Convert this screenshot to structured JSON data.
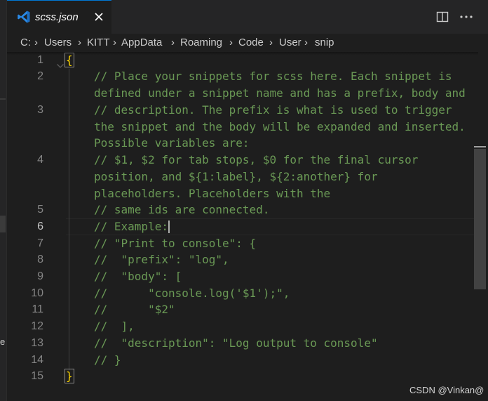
{
  "tab": {
    "icon": "vscode-file-icon",
    "label": "scss.json",
    "close_icon": "close-icon"
  },
  "toolbar": {
    "split_icon": "split-editor-icon",
    "more_icon": "more-actions-icon"
  },
  "breadcrumb": [
    "C:",
    "Users",
    "KITT",
    "AppData",
    "Roaming",
    "Code",
    "User",
    "snip"
  ],
  "editor": {
    "lines": [
      {
        "num": "1",
        "segments": [
          "{"
        ]
      },
      {
        "num": "2",
        "segments": [
          "// Place your snippets for scss here. Each snippet is",
          "defined under a snippet name and has a prefix, body and"
        ]
      },
      {
        "num": "3",
        "segments": [
          "// description. The prefix is what is used to trigger",
          "the snippet and the body will be expanded and inserted.",
          "Possible variables are:"
        ]
      },
      {
        "num": "4",
        "segments": [
          "// $1, $2 for tab stops, $0 for the final cursor",
          "position, and ${1:label}, ${2:another} for",
          "placeholders. Placeholders with the"
        ]
      },
      {
        "num": "5",
        "segments": [
          "// same ids are connected."
        ]
      },
      {
        "num": "6",
        "segments": [
          "// Example:"
        ]
      },
      {
        "num": "7",
        "segments": [
          "// \"Print to console\": {"
        ]
      },
      {
        "num": "8",
        "segments": [
          "//  \"prefix\": \"log\","
        ]
      },
      {
        "num": "9",
        "segments": [
          "//  \"body\": ["
        ]
      },
      {
        "num": "10",
        "segments": [
          "//      \"console.log('$1');\","
        ]
      },
      {
        "num": "11",
        "segments": [
          "//      \"$2\""
        ]
      },
      {
        "num": "12",
        "segments": [
          "//  ],"
        ]
      },
      {
        "num": "13",
        "segments": [
          "//  \"description\": \"Log output to console\""
        ]
      },
      {
        "num": "14",
        "segments": [
          "// }"
        ]
      },
      {
        "num": "15",
        "segments": [
          "}"
        ]
      }
    ],
    "active_line": "6",
    "fold_icon": "chevron-down-icon"
  },
  "colors": {
    "comment": "#6a9955",
    "brace": "#ffd700",
    "accent": "#0078d4",
    "background": "#1e1e1e"
  },
  "watermark": "CSDN @Vinkan@"
}
